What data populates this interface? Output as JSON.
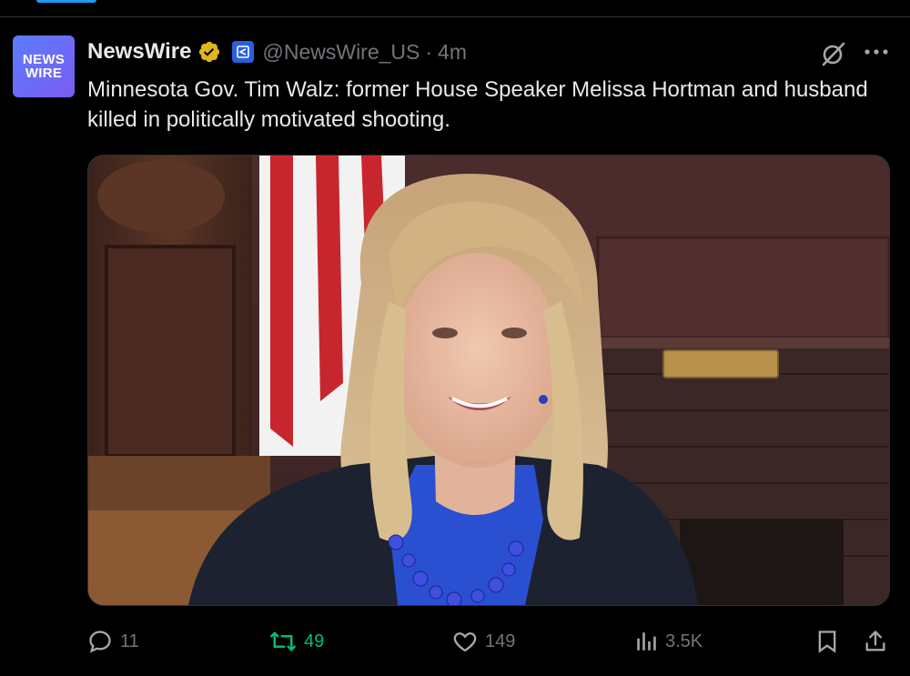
{
  "account": {
    "display_name": "NewsWire",
    "handle": "@NewsWire_US",
    "separator": "·",
    "time": "4m",
    "avatar_line1": "NEWS",
    "avatar_line2": "WIRE",
    "verified": "gold",
    "accent_color": "#1d9bf0"
  },
  "tweet": {
    "text": "Minnesota Gov. Tim Walz: former House Speaker Melissa Hortman and husband killed in politically motivated shooting."
  },
  "media": {
    "type": "photo"
  },
  "actions": {
    "replies": "11",
    "reposts": "49",
    "likes": "149",
    "views": "3.5K"
  },
  "colors": {
    "background": "#000000",
    "text": "#e7e9ea",
    "muted": "#71767b",
    "repost_active": "#00ba7c",
    "verified_gold": "#e2b719"
  }
}
